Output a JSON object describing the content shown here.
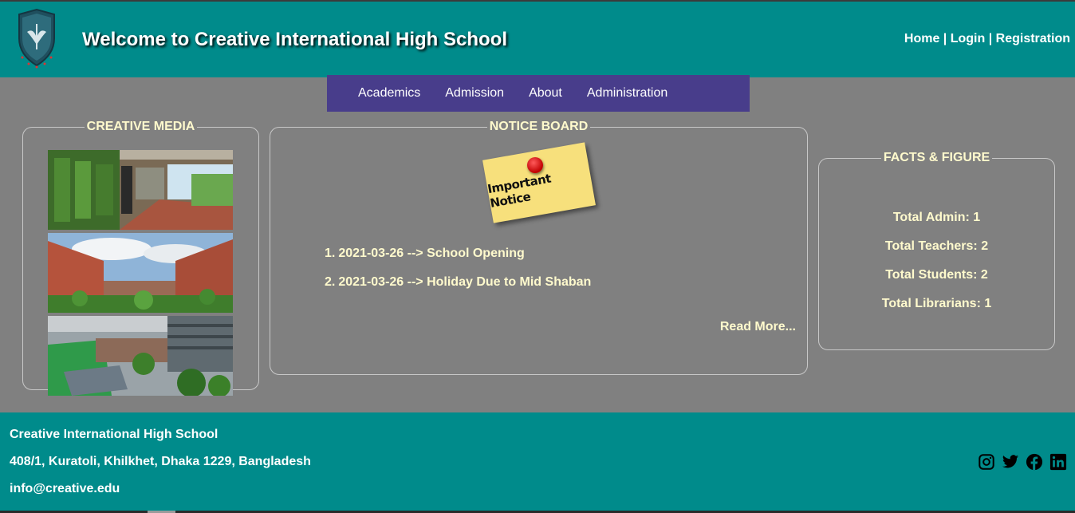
{
  "header": {
    "title": "Welcome to Creative International High School",
    "links": [
      "Home",
      "Login",
      "Registration"
    ],
    "separator": " | ",
    "logo_icon": "shield-crest-logo"
  },
  "nav": {
    "items": [
      "Academics",
      "Admission",
      "About",
      "Administration"
    ]
  },
  "media": {
    "legend": "CREATIVE MEDIA",
    "photos": [
      "green-corridor-photo",
      "courtyard-garden-photo",
      "rooftop-garden-photo"
    ]
  },
  "notice_board": {
    "legend": "NOTICE BOARD",
    "sticky_text": "Important Notice",
    "items": [
      {
        "num": "1.",
        "text": "2021-03-26 --> School Opening"
      },
      {
        "num": "2.",
        "text": "2021-03-26 --> Holiday Due to Mid Shaban"
      }
    ],
    "read_more": "Read More..."
  },
  "facts": {
    "legend": "FACTS & FIGURE",
    "items": [
      "Total Admin: 1",
      "Total Teachers: 2",
      "Total Students: 2",
      "Total Librarians: 1"
    ]
  },
  "footer": {
    "name": "Creative International High School",
    "address": "408/1, Kuratoli, Khilkhet, Dhaka 1229, Bangladesh",
    "email": "info@creative.edu",
    "social": [
      "instagram-icon",
      "twitter-icon",
      "facebook-icon",
      "linkedin-icon"
    ]
  },
  "colors": {
    "header_bg": "#008b8b",
    "nav_bg": "#483d8b",
    "page_bg": "#808080",
    "accent_text": "#fffacd"
  }
}
